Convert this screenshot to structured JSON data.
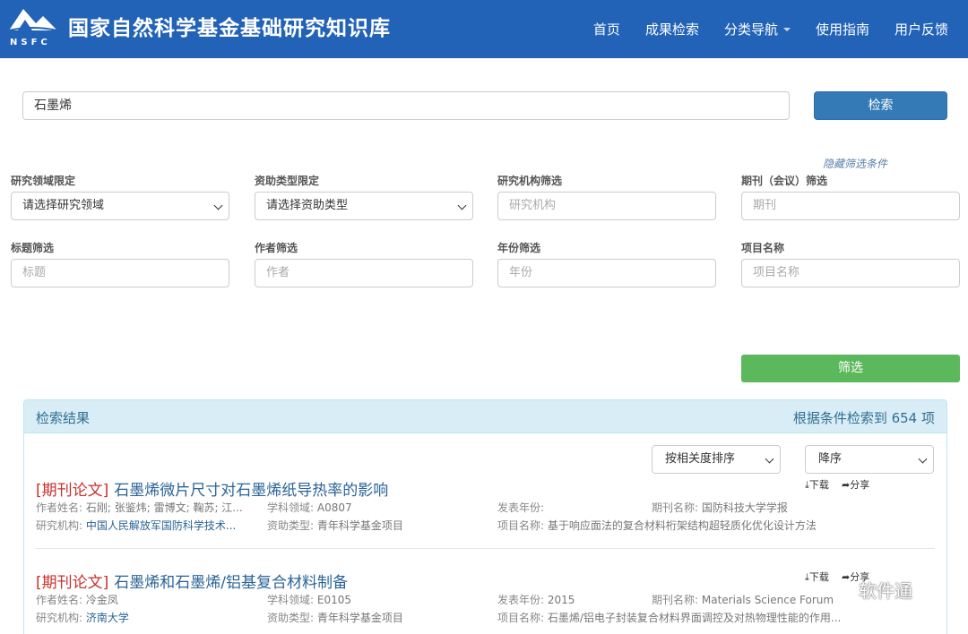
{
  "header": {
    "logo_text": "NSFC",
    "title": "国家自然科学基金基础研究知识库",
    "nav": [
      "首页",
      "成果检索",
      "分类导航",
      "使用指南",
      "用户反馈"
    ]
  },
  "search": {
    "value": "石墨烯",
    "button": "检索"
  },
  "filters": {
    "hide_link": "隐藏筛选条件",
    "field": {
      "label": "研究领域限定",
      "value": "请选择研究领域"
    },
    "funding": {
      "label": "资助类型限定",
      "value": "请选择资助类型"
    },
    "institution": {
      "label": "研究机构筛选",
      "placeholder": "研究机构"
    },
    "journal": {
      "label": "期刊（会议）筛选",
      "placeholder": "期刊"
    },
    "title": {
      "label": "标题筛选",
      "placeholder": "标题"
    },
    "author": {
      "label": "作者筛选",
      "placeholder": "作者"
    },
    "year": {
      "label": "年份筛选",
      "placeholder": "年份"
    },
    "project": {
      "label": "项目名称",
      "placeholder": "项目名称"
    },
    "button": "筛选"
  },
  "results": {
    "heading": "检索结果",
    "count_text": "根据条件检索到 654 项",
    "sort_by": "按相关度排序",
    "order": "降序",
    "items": [
      {
        "type": "[期刊论文]",
        "title": "石墨烯微片尺寸对石墨烯纸导热率的影响",
        "authors_label": "作者姓名:",
        "authors": "石刚; 张鉴炜; 雷博文; 鞠苏; 江...",
        "subject_label": "学科领域:",
        "subject": "A0807",
        "year_label": "发表年份:",
        "year": "",
        "journal_label": "期刊名称:",
        "journal": "国防科技大学学报",
        "inst_label": "研究机构:",
        "institution": "中国人民解放军国防科学技术...",
        "funding_label": "资助类型:",
        "funding": "青年科学基金项目",
        "project_label": "项目名称:",
        "project": "基于响应面法的复合材料桁架结构超轻质化优化设计方法",
        "download": "下载",
        "share": "分享"
      },
      {
        "type": "[期刊论文]",
        "title": "石墨烯和石墨烯/铝基复合材料制备",
        "authors_label": "作者姓名:",
        "authors": "冷金凤",
        "subject_label": "学科领域:",
        "subject": "E0105",
        "year_label": "发表年份:",
        "year": "2015",
        "journal_label": "期刊名称:",
        "journal": "Materials Science Forum",
        "inst_label": "研究机构:",
        "institution": "济南大学",
        "funding_label": "资助类型:",
        "funding": "青年科学基金项目",
        "project_label": "项目名称:",
        "project": "石墨烯/铝电子封装复合材料界面调控及对热物理性能的作用...",
        "download": "下载",
        "share": "分享"
      }
    ]
  },
  "watermark": "软件通",
  "colors": {
    "header": "#2263b7",
    "primary": "#337ab7",
    "success": "#5cb85c",
    "doc_type": "#c9302c",
    "link": "#2a6496"
  }
}
